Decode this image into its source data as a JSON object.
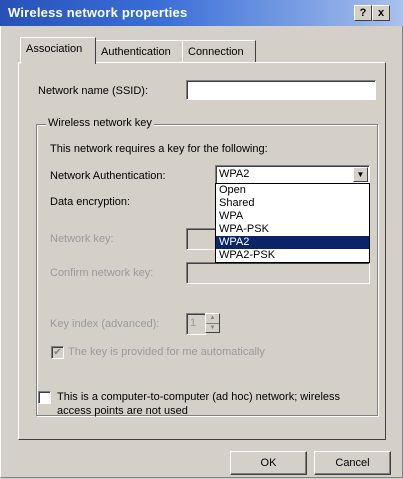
{
  "window": {
    "title": "Wireless network properties",
    "help_label": "?",
    "close_label": "x"
  },
  "tabs": [
    {
      "label": "Association"
    },
    {
      "label": "Authentication"
    },
    {
      "label": "Connection"
    }
  ],
  "association": {
    "ssid_label": "Network name (SSID):",
    "ssid_value": "",
    "group_title": "Wireless network key",
    "requires_text": "This network requires a key for the following:",
    "auth_label": "Network Authentication:",
    "auth_selected": "WPA2",
    "auth_options": [
      "Open",
      "Shared",
      "WPA",
      "WPA-PSK",
      "WPA2",
      "WPA2-PSK"
    ],
    "encryption_label": "Data encryption:",
    "network_key_label": "Network key:",
    "confirm_key_label": "Confirm network key:",
    "key_index_label": "Key index (advanced):",
    "key_index_value": "1",
    "auto_key_label": "The key is provided for me automatically",
    "adhoc_label_line1": "This is a computer-to-computer (ad hoc) network; wireless",
    "adhoc_label_line2": "access points are not used"
  },
  "buttons": {
    "ok": "OK",
    "cancel": "Cancel"
  },
  "icons": {
    "dropdown": "chevron-down-icon",
    "check": "checkmark-icon"
  }
}
